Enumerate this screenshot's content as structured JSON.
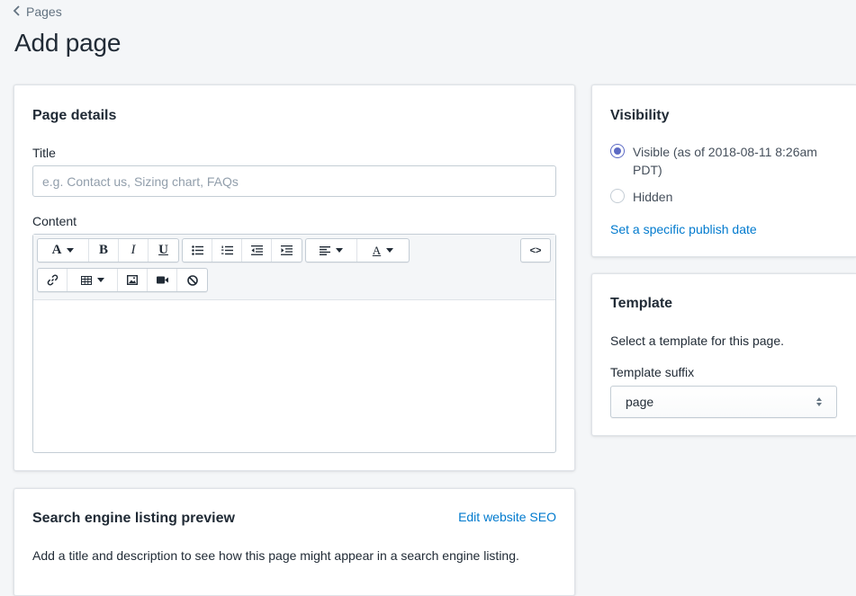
{
  "breadcrumb": {
    "label": "Pages"
  },
  "page": {
    "title": "Add page"
  },
  "details": {
    "heading": "Page details",
    "title_label": "Title",
    "title_value": "",
    "title_placeholder": "e.g. Contact us, Sizing chart, FAQs",
    "content_label": "Content",
    "toolbar": {
      "font_button": "A",
      "bold_button": "B",
      "italic_button": "I",
      "underline_button": "U",
      "text_color_button": "A",
      "html_button": "<>"
    }
  },
  "seo": {
    "heading": "Search engine listing preview",
    "edit_link": "Edit website SEO",
    "description": "Add a title and description to see how this page might appear in a search engine listing."
  },
  "visibility": {
    "heading": "Visibility",
    "options": [
      {
        "label": "Visible (as of 2018-08-11 8:26am PDT)",
        "selected": true
      },
      {
        "label": "Hidden",
        "selected": false
      }
    ],
    "publish_link": "Set a specific publish date"
  },
  "template": {
    "heading": "Template",
    "description": "Select a template for this page.",
    "suffix_label": "Template suffix",
    "suffix_value": "page"
  },
  "colors": {
    "accent": "#5c6ac4",
    "link": "#007ace",
    "background": "#f4f6f8"
  }
}
